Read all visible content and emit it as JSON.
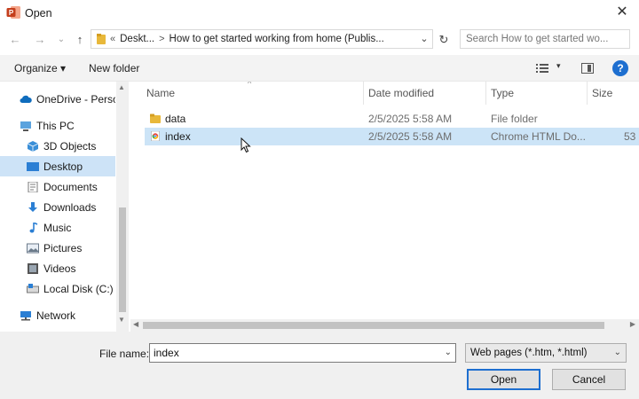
{
  "window": {
    "title": "Open",
    "close_glyph": "✕",
    "app_icon": "powerpoint-icon"
  },
  "nav": {
    "back_glyph": "←",
    "forward_glyph": "→",
    "recent_glyph": "⌄",
    "up_glyph": "↑",
    "address_prefix": "«",
    "address_segment_1": "Deskt...",
    "address_chevron": ">",
    "address_segment_2": "How to get started working from home (Publis...",
    "address_dropdown": "⌄",
    "refresh_glyph": "↻",
    "search_placeholder": "Search How to get started wo..."
  },
  "toolbar": {
    "organize_label": "Organize ▾",
    "new_folder_label": "New folder",
    "view_dropdown": "▾",
    "help_label": "?"
  },
  "sidebar": {
    "items": [
      {
        "label": "OneDrive - Person",
        "icon": "cloud-icon"
      },
      {
        "label": "This PC",
        "icon": "computer-icon"
      },
      {
        "label": "3D Objects",
        "icon": "cube-icon"
      },
      {
        "label": "Desktop",
        "icon": "desktop-icon"
      },
      {
        "label": "Documents",
        "icon": "document-icon"
      },
      {
        "label": "Downloads",
        "icon": "download-icon"
      },
      {
        "label": "Music",
        "icon": "music-icon"
      },
      {
        "label": "Pictures",
        "icon": "picture-icon"
      },
      {
        "label": "Videos",
        "icon": "video-icon"
      },
      {
        "label": "Local Disk (C:)",
        "icon": "disk-icon"
      },
      {
        "label": "Network",
        "icon": "network-icon"
      }
    ],
    "selected": "Desktop"
  },
  "filelist": {
    "columns": {
      "name": "Name",
      "date": "Date modified",
      "type": "Type",
      "size": "Size"
    },
    "sort_caret": "^",
    "rows": [
      {
        "name": "data",
        "date": "2/5/2025 5:58 AM",
        "type": "File folder",
        "size": "",
        "icon": "folder-icon"
      },
      {
        "name": "index",
        "date": "2/5/2025 5:58 AM",
        "type": "Chrome HTML Do...",
        "size": "53",
        "icon": "chrome-html-icon"
      }
    ],
    "selected": "index"
  },
  "footer": {
    "file_name_label": "File name:",
    "file_name_value": "index",
    "file_name_dropdown": "⌄",
    "file_type_value": "Web pages (*.htm, *.html)",
    "file_type_dropdown": "⌄",
    "open_label": "Open",
    "cancel_label": "Cancel"
  },
  "colors": {
    "accent": "#1e6fd0",
    "selection": "#cce4f7",
    "folder": "#e8b83a"
  }
}
